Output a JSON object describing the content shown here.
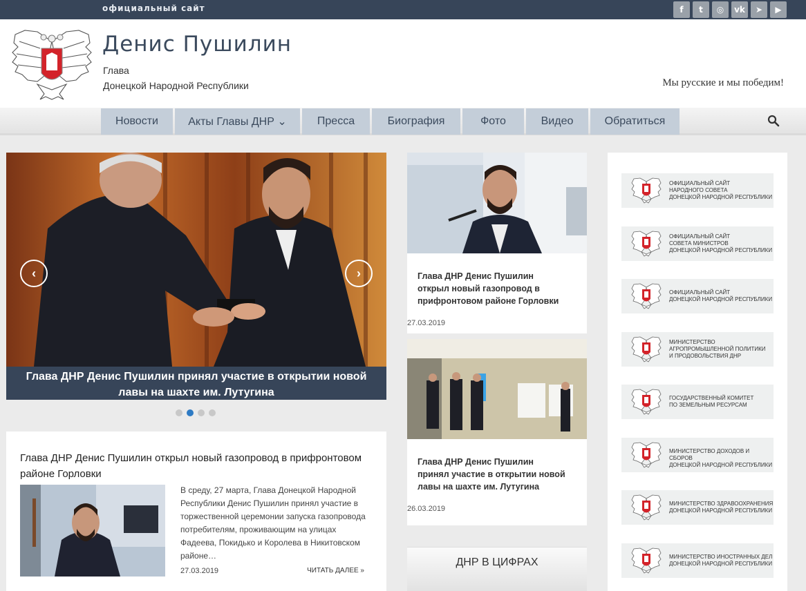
{
  "topbar": {
    "tagline": "официальный сайт",
    "social": [
      {
        "icon": "facebook-icon",
        "glyph": "f"
      },
      {
        "icon": "twitter-icon",
        "glyph": "t"
      },
      {
        "icon": "instagram-icon",
        "glyph": "◎"
      },
      {
        "icon": "vk-icon",
        "glyph": "vk"
      },
      {
        "icon": "telegram-icon",
        "glyph": "➤"
      },
      {
        "icon": "youtube-icon",
        "glyph": "▶"
      }
    ]
  },
  "header": {
    "title": "Денис Пушилин",
    "subtitle_line1": "Глава",
    "subtitle_line2": "Донецкой Народной Республики",
    "motto": "Мы русские и мы победим!"
  },
  "nav": {
    "items": [
      {
        "label": "Новости",
        "w": 104
      },
      {
        "label": "Акты Главы ДНР ⌄",
        "w": 181
      },
      {
        "label": "Пресса",
        "w": 98
      },
      {
        "label": "Биография",
        "w": 128
      },
      {
        "label": "Фото",
        "w": 89
      },
      {
        "label": "Видео",
        "w": 90
      },
      {
        "label": "Обратиться",
        "w": 129
      }
    ]
  },
  "slider": {
    "caption": "Глава ДНР Денис Пушилин принял участие в открытии новой лавы на шахте им. Лутугина",
    "prev": "‹",
    "next": "›",
    "active_index": 1,
    "count": 4
  },
  "featured": {
    "title": "Глава ДНР Денис Пушилин открыл новый газопровод в прифронтовом районе Горловки",
    "excerpt": "В среду, 27 марта, Глава Донецкой Народной Республики Денис Пушилин принял участие в торжественной церемонии запуска газопровода потребителям, проживающим на улицах Фадеева, Покидько и Королева в Никитовском районе…",
    "date": "27.03.2019",
    "read_more": "ЧИТАТЬ ДАЛЕЕ »"
  },
  "cards": [
    {
      "title": "Глава ДНР Денис Пушилин открыл новый газопровод в прифронтовом районе Горловки",
      "date": "27.03.2019"
    },
    {
      "title": "Глава ДНР Денис Пушилин принял участие в открытии новой лавы на шахте им. Лутугина",
      "date": "26.03.2019"
    }
  ],
  "section_title": "ДНР В ЦИФРАХ",
  "banners": [
    [
      "ОФИЦИАЛЬНЫЙ САЙТ",
      "НАРОДНОГО СОВЕТА",
      "ДОНЕЦКОЙ НАРОДНОЙ РЕСПУБЛИКИ"
    ],
    [
      "ОФИЦИАЛЬНЫЙ САЙТ",
      "СОВЕТА МИНИСТРОВ",
      "ДОНЕЦКОЙ НАРОДНОЙ РЕСПУБЛИКИ"
    ],
    [
      "ОФИЦИАЛЬНЫЙ САЙТ",
      "ДОНЕЦКОЙ НАРОДНОЙ РЕСПУБЛИКИ"
    ],
    [
      "МИНИСТЕРСТВО",
      "АГРОПРОМЫШЛЕННОЙ ПОЛИТИКИ",
      "И ПРОДОВОЛЬСТВИЯ ДНР"
    ],
    [
      "ГОСУДАРСТВЕННЫЙ КОМИТЕТ",
      "ПО ЗЕМЕЛЬНЫМ РЕСУРСАМ"
    ],
    [
      "МИНИСТЕРСТВО ДОХОДОВ И СБОРОВ",
      "ДОНЕЦКОЙ НАРОДНОЙ РЕСПУБЛИКИ"
    ],
    [
      "МИНИСТЕРСТВО ЗДРАВООХРАНЕНИЯ",
      "ДОНЕЦКОЙ НАРОДНОЙ РЕСПУБЛИКИ"
    ],
    [
      "МИНИСТЕРСТВО ИНОСТРАННЫХ ДЕЛ",
      "ДОНЕЦКОЙ НАРОДНОЙ РЕСПУБЛИКИ"
    ]
  ],
  "colors": {
    "topbar": "#374559",
    "nav_tab": "#c4ced9",
    "accent": "#2e7bc4"
  }
}
